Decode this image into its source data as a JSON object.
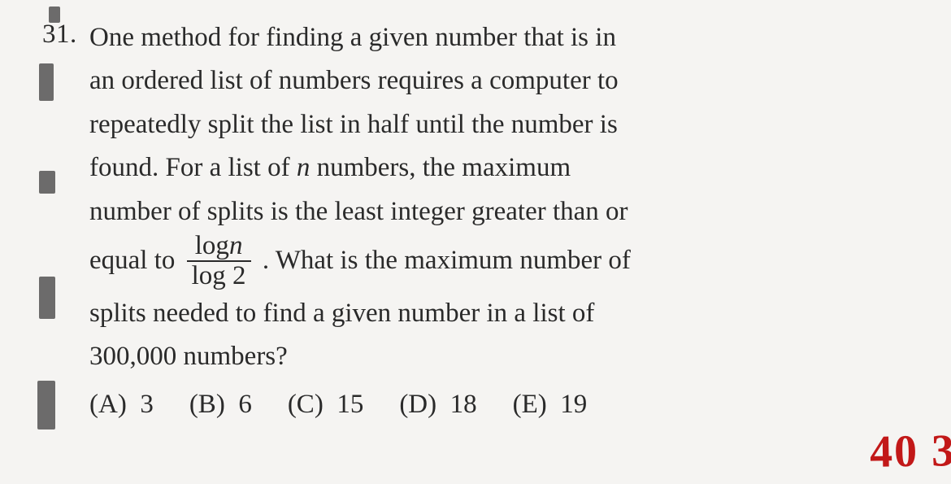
{
  "question": {
    "number": "31.",
    "line1": "One method for finding a given number that is in",
    "line2": "an ordered list of numbers requires a computer to",
    "line3": "repeatedly split the list in half until the number is",
    "line4_a": "found. For a list of ",
    "line4_var": "n",
    "line4_b": " numbers, the maximum",
    "line5": "number of splits is the least integer greater than or",
    "line6_a": "equal to ",
    "frac_num_a": "log",
    "frac_num_var": "n",
    "frac_den": "log 2",
    "line6_b": ". What is the maximum number of",
    "line7": "splits needed to find a given number in a list of",
    "line8": "300,000 numbers?"
  },
  "choices": {
    "a_label": "(A)",
    "a_val": "3",
    "b_label": "(B)",
    "b_val": "6",
    "c_label": "(C)",
    "c_val": "15",
    "d_label": "(D)",
    "d_val": "18",
    "e_label": "(E)",
    "e_val": "19"
  },
  "handwriting": "40 3"
}
